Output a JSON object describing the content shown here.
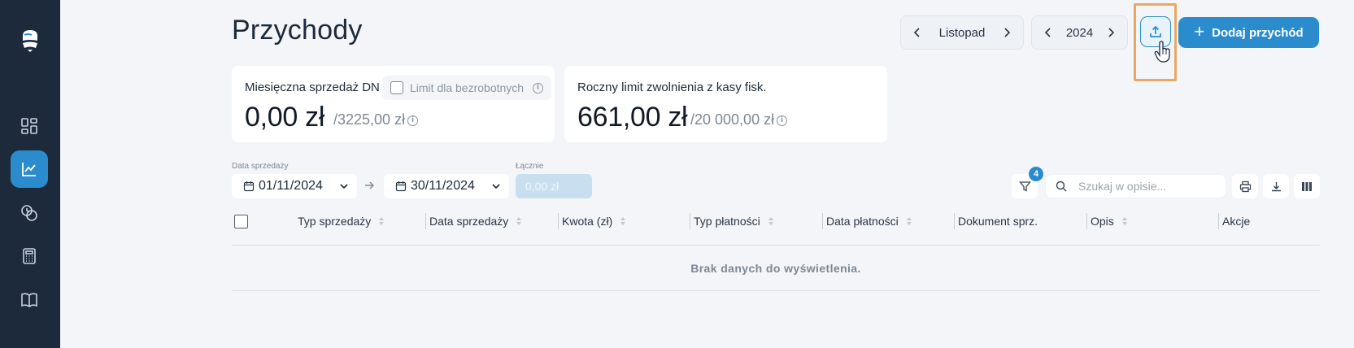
{
  "sidebar": {
    "items": [
      {
        "icon": "dashboard-icon"
      },
      {
        "icon": "chart-icon",
        "active": true
      },
      {
        "icon": "coins-icon"
      },
      {
        "icon": "calculator-icon"
      },
      {
        "icon": "book-icon"
      }
    ]
  },
  "header": {
    "title": "Przychody",
    "month": "Listopad",
    "year": "2024",
    "add_label": "Dodaj przychód"
  },
  "cards": {
    "monthly": {
      "label": "Miesięczna sprzedaż DN",
      "checkbox_label": "Limit dla bezrobotnych",
      "value": "0,00 zł",
      "limit": "/3225,00 zł"
    },
    "yearly": {
      "label": "Roczny limit zwolnienia z kasy fisk.",
      "value": "661,00 zł",
      "limit": "/20 000,00 zł"
    }
  },
  "filters": {
    "date_label": "Data sprzedaży",
    "date_from": "01/11/2024",
    "date_to": "30/11/2024",
    "total_label": "Łącznie",
    "total_value": "0,00 zł",
    "filter_badge": "4",
    "search_placeholder": "Szukaj w opisie..."
  },
  "table": {
    "columns": [
      "Typ sprzedaży",
      "Data sprzedaży",
      "Kwota (zł)",
      "Typ płatności",
      "Data płatności",
      "Dokument sprz.",
      "Opis",
      "Akcje"
    ],
    "empty_text": "Brak danych do wyświetlenia."
  },
  "colors": {
    "accent": "#2b8ccd",
    "sidebar": "#1c2a3b",
    "highlight": "#e9a862"
  }
}
